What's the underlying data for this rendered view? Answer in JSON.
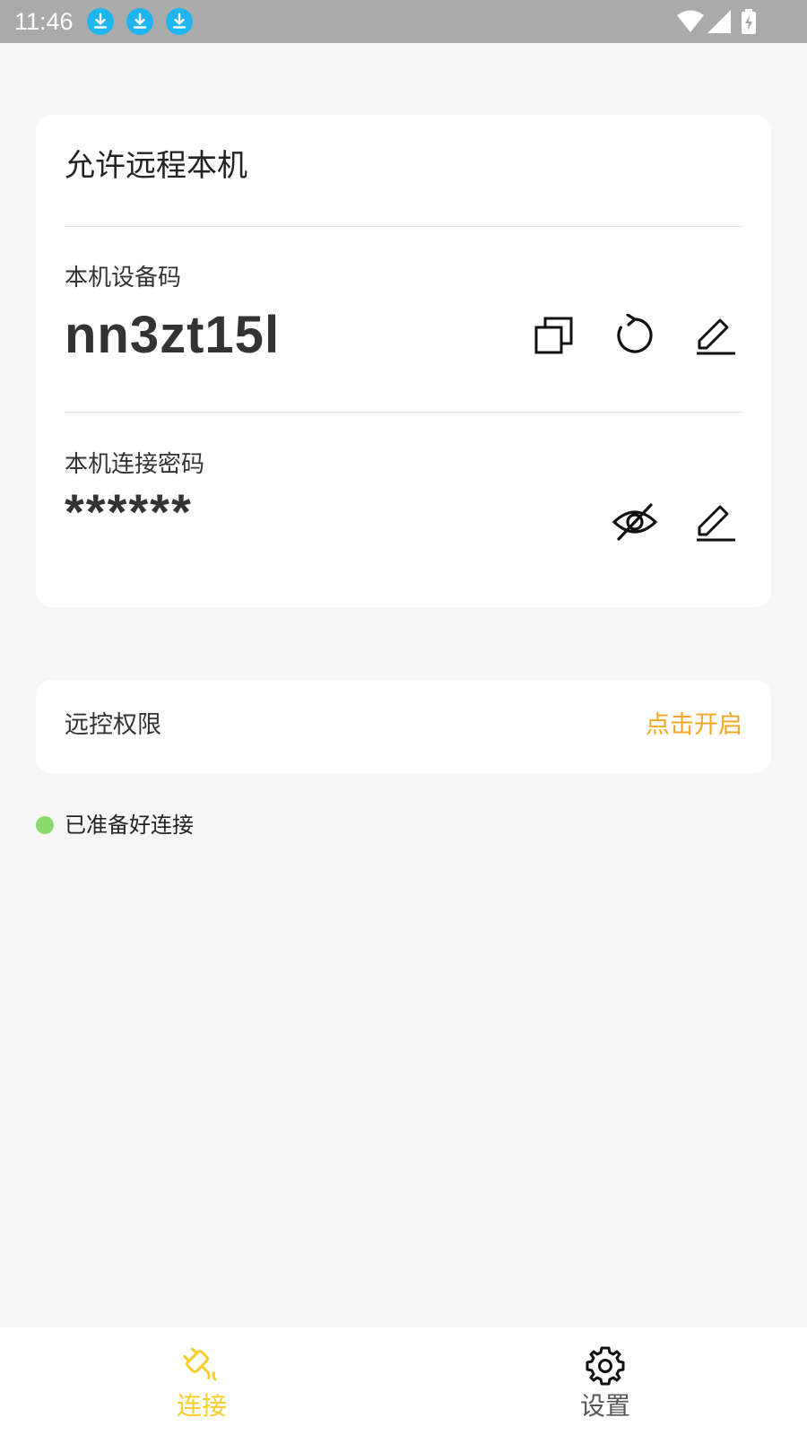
{
  "status_bar": {
    "time": "11:46",
    "icons": [
      "download-icon",
      "download-icon",
      "download-icon",
      "wifi-icon",
      "signal-icon",
      "battery-charging-icon"
    ]
  },
  "remote_card": {
    "title": "允许远程本机",
    "device_code_label": "本机设备码",
    "device_code": "nn3zt15l",
    "password_label": "本机连接密码",
    "password_masked": "******",
    "device_actions": [
      "copy-icon",
      "refresh-icon",
      "edit-icon"
    ],
    "password_actions": [
      "eye-off-icon",
      "edit-icon"
    ]
  },
  "permission_card": {
    "label": "远控权限",
    "action": "点击开启"
  },
  "connection_status": {
    "text": "已准备好连接"
  },
  "bottom_nav": {
    "items": [
      {
        "label": "连接",
        "icon": "plug-icon",
        "active": true
      },
      {
        "label": "设置",
        "icon": "gear-icon",
        "active": false
      }
    ]
  },
  "colors": {
    "accent_active": "#f5cf2a",
    "action_orange": "#f5a623",
    "status_green": "#8adb6f",
    "status_bar": "#aaaaaa",
    "download_icon_bg": "#1fb5f0"
  }
}
